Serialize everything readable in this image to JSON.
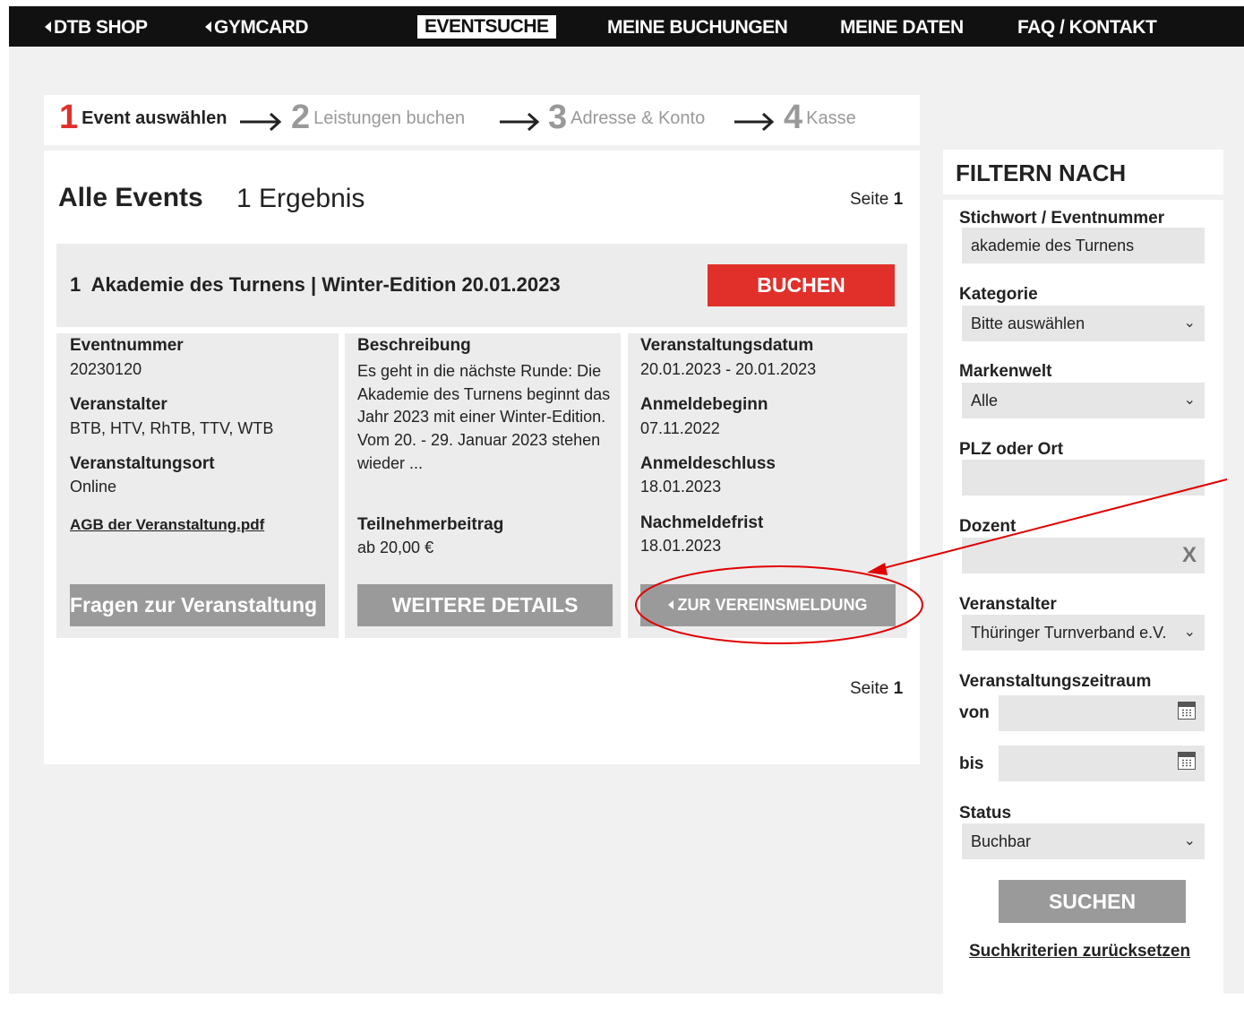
{
  "nav": {
    "items": [
      {
        "label": "DTB SHOP",
        "back": true
      },
      {
        "label": "GYMCARD",
        "back": true
      },
      {
        "label": "EVENTSUCHE",
        "active": true
      },
      {
        "label": "MEINE BUCHUNGEN"
      },
      {
        "label": "MEINE DATEN"
      },
      {
        "label": "FAQ / KONTAKT"
      }
    ]
  },
  "steps": [
    {
      "num": "1",
      "label": "Event auswählen"
    },
    {
      "num": "2",
      "label": "Leistungen buchen"
    },
    {
      "num": "3",
      "label": "Adresse & Konto"
    },
    {
      "num": "4",
      "label": "Kasse"
    }
  ],
  "results": {
    "title": "Alle Events",
    "count": "1 Ergebnis",
    "page_label": "Seite",
    "page": "1"
  },
  "event": {
    "index": "1",
    "title": "Akademie des Turnens | Winter-Edition 20.01.2023",
    "book_label": "BUCHEN",
    "eventnummer_label": "Eventnummer",
    "eventnummer": "20230120",
    "veranstalter_label": "Veranstalter",
    "veranstalter": "BTB, HTV, RhTB, TTV, WTB",
    "ort_label": "Veranstaltungsort",
    "ort": "Online",
    "agb_link": "AGB der Veranstaltung.pdf",
    "beschreibung_label": "Beschreibung",
    "beschreibung": "Es geht in die nächste Runde: Die Akademie des Turnens beginnt das Jahr 2023 mit einer Winter-Edition. Vom 20. - 29. Januar 2023 stehen wieder ...",
    "beitrag_label": "Teilnehmerbeitrag",
    "beitrag": "ab 20,00 €",
    "datum_label": "Veranstaltungsdatum",
    "datum": "20.01.2023 - 20.01.2023",
    "anmeldebeginn_label": "Anmeldebeginn",
    "anmeldebeginn": "07.11.2022",
    "anmeldeschluss_label": "Anmeldeschluss",
    "anmeldeschluss": "18.01.2023",
    "nachmeldefrist_label": "Nachmeldefrist",
    "nachmeldefrist": "18.01.2023",
    "fragen_button": "Fragen zur Veranstaltung",
    "details_button": "WEITERE DETAILS",
    "vereinsmeldung_button": "ZUR VEREINSMELDUNG"
  },
  "filter": {
    "title": "FILTERN NACH",
    "stichwort_label": "Stichwort / Eventnummer",
    "stichwort_value": "akademie des Turnens",
    "kategorie_label": "Kategorie",
    "kategorie_value": "Bitte auswählen",
    "markenwelt_label": "Markenwelt",
    "markenwelt_value": "Alle",
    "plz_label": "PLZ oder Ort",
    "plz_value": "",
    "dozent_label": "Dozent",
    "dozent_value": "",
    "clear_glyph": "X",
    "veranstalter_label": "Veranstalter",
    "veranstalter_value": "Thüringer Turnverband e.V.",
    "zeitraum_label": "Veranstaltungszeitraum",
    "von_label": "von",
    "bis_label": "bis",
    "status_label": "Status",
    "status_value": "Buchbar",
    "search_button": "SUCHEN",
    "reset_link": "Suchkriterien zurücksetzen"
  },
  "colors": {
    "accent_red": "#e1302a",
    "nav_bg": "#111111",
    "button_gray": "#9a9a9a",
    "annotation_red": "#e10000"
  }
}
